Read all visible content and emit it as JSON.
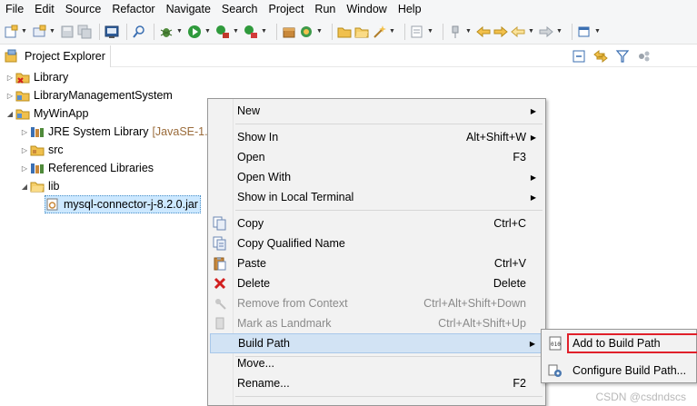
{
  "menubar": {
    "items": [
      "File",
      "Edit",
      "Source",
      "Refactor",
      "Navigate",
      "Search",
      "Project",
      "Run",
      "Window",
      "Help"
    ]
  },
  "toolbar": {
    "icons": [
      "new-icon",
      "open-type-icon",
      "save-icon",
      "save-all-icon",
      "terminal-icon",
      "search-icon",
      "debug-icon",
      "run-icon",
      "run-external-icon",
      "coverage-icon",
      "package-icon",
      "refresh-icon",
      "folder-icon",
      "folder-open-icon",
      "wand-icon",
      "edit-icon",
      "pin-icon",
      "back-icon",
      "forward-icon",
      "prev-icon",
      "next-icon",
      "maximize-icon"
    ]
  },
  "explorer": {
    "title": "Project Explorer",
    "tree": [
      {
        "label": "Library",
        "icon": "project-error-icon"
      },
      {
        "label": "LibraryManagementSystem",
        "icon": "project-icon"
      },
      {
        "label": "MyWinApp",
        "icon": "project-icon"
      },
      {
        "label": "JRE System Library",
        "suffix": "[JavaSE-1.",
        "icon": "library-icon"
      },
      {
        "label": "src",
        "icon": "source-folder-icon"
      },
      {
        "label": "Referenced Libraries",
        "icon": "library-icon"
      },
      {
        "label": "lib",
        "icon": "folder-icon"
      },
      {
        "label": "mysql-connector-j-8.2.0.jar",
        "icon": "jar-icon"
      }
    ]
  },
  "context_menu": {
    "items": [
      {
        "label": "New",
        "key": "",
        "submenu": true
      },
      {
        "label": "Show In",
        "key": "Alt+Shift+W",
        "submenu": true
      },
      {
        "label": "Open",
        "key": "F3"
      },
      {
        "label": "Open With",
        "key": "",
        "submenu": true
      },
      {
        "label": "Show in Local Terminal",
        "key": "",
        "submenu": true
      },
      {
        "label": "Copy",
        "key": "Ctrl+C"
      },
      {
        "label": "Copy Qualified Name",
        "key": ""
      },
      {
        "label": "Paste",
        "key": "Ctrl+V"
      },
      {
        "label": "Delete",
        "key": "Delete"
      },
      {
        "label": "Remove from Context",
        "key": "Ctrl+Alt+Shift+Down",
        "disabled": true
      },
      {
        "label": "Mark as Landmark",
        "key": "Ctrl+Alt+Shift+Up",
        "disabled": true
      },
      {
        "label": "Build Path",
        "key": "",
        "submenu": true,
        "hover": true
      },
      {
        "label": "Move...",
        "key": ""
      },
      {
        "label": "Rename...",
        "key": "F2"
      }
    ]
  },
  "submenu": {
    "items": [
      {
        "label": "Add to Build Path"
      },
      {
        "label": "Configure Build Path..."
      }
    ]
  },
  "watermark": "CSDN @csdndscs",
  "colors": {
    "selection": "#cce8ff",
    "menu_hover": "#d2e3f4",
    "highlight_border": "#e0202a",
    "delete_red": "#d21f1f"
  }
}
